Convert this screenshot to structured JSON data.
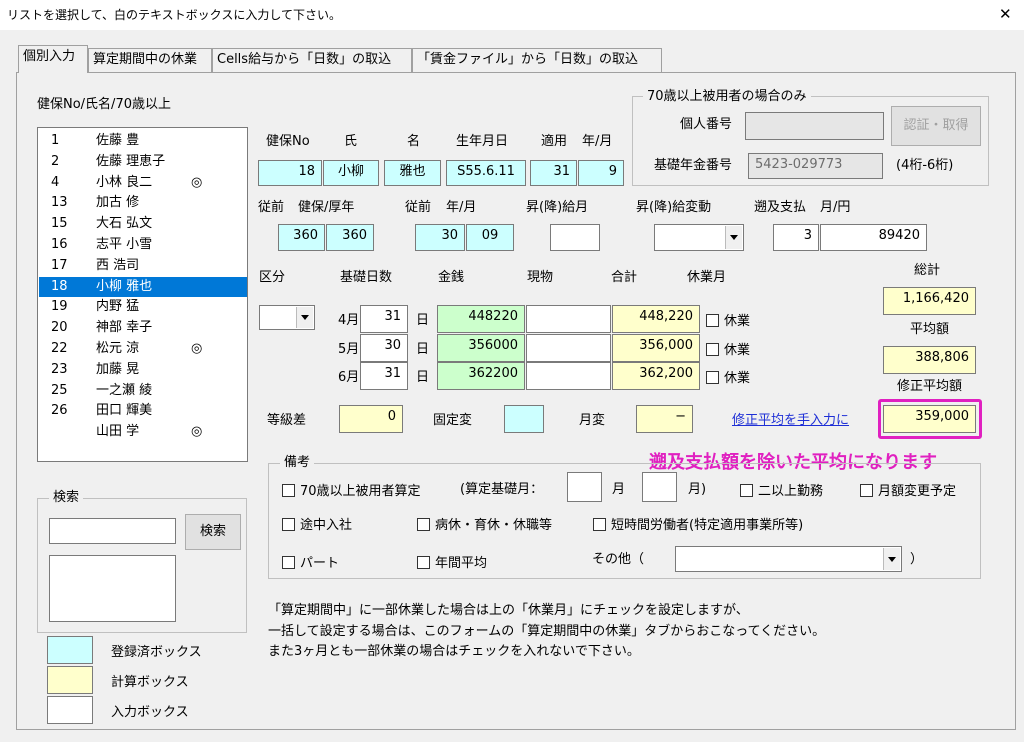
{
  "window": {
    "title": "リストを選択して、白のテキストボックスに入力して下さい。",
    "close_glyph": "✕"
  },
  "tabs": [
    "個別入力",
    "算定期間中の休業",
    "Cells給与から「日数」の取込",
    "「賃金ファイル」から「日数」の取込"
  ],
  "list_section": {
    "title": "健保No/氏名/70歳以上",
    "items": [
      {
        "no": "1",
        "name": "佐藤 豊",
        "mark": ""
      },
      {
        "no": "2",
        "name": "佐藤 理恵子",
        "mark": ""
      },
      {
        "no": "4",
        "name": "小林 良二",
        "mark": "◎"
      },
      {
        "no": "13",
        "name": "加古 修",
        "mark": ""
      },
      {
        "no": "15",
        "name": "大石 弘文",
        "mark": ""
      },
      {
        "no": "16",
        "name": "志平 小雪",
        "mark": ""
      },
      {
        "no": "17",
        "name": "西 浩司",
        "mark": ""
      },
      {
        "no": "18",
        "name": "小柳 雅也",
        "mark": ""
      },
      {
        "no": "19",
        "name": "内野 猛",
        "mark": ""
      },
      {
        "no": "20",
        "name": "神部 幸子",
        "mark": ""
      },
      {
        "no": "22",
        "name": "松元 涼",
        "mark": "◎"
      },
      {
        "no": "23",
        "name": "加藤 晃",
        "mark": ""
      },
      {
        "no": "25",
        "name": "一之瀬 綾",
        "mark": ""
      },
      {
        "no": "26",
        "name": "田口 輝美",
        "mark": ""
      },
      {
        "no": "",
        "name": "山田 学",
        "mark": "◎"
      }
    ],
    "selected_index": 7
  },
  "search": {
    "group_label": "検索",
    "input_value": "",
    "button_label": "検索",
    "result_value": ""
  },
  "legend": [
    {
      "label": "登録済ボックス",
      "color": "#ccffff"
    },
    {
      "label": "計算ボックス",
      "color": "#ffffcc"
    },
    {
      "label": "入力ボックス",
      "color": "#ffffff"
    }
  ],
  "employee": {
    "labels": {
      "kenpo": "健保No",
      "shi": "氏",
      "mei": "名",
      "birth": "生年月日",
      "tekiyo": "適用",
      "nengetsu": "年/月"
    },
    "kenpo_no": "18",
    "last_name": "小柳",
    "first_name": "雅也",
    "birthdate": "S55.6.11",
    "tekiyo_year": "31",
    "tekiyo_month": "9"
  },
  "over70": {
    "group_label": "70歳以上被用者の場合のみ",
    "kojin_label": "個人番号",
    "kojin_value": "",
    "auth_button": "認証・取得",
    "kiso_label": "基礎年金番号",
    "kiso_value": "5423-029773",
    "kiso_hint": "(4桁-6桁)"
  },
  "prev": {
    "labels": {
      "juzen1": "従前",
      "kenpo_kosei": "健保/厚年",
      "juzen2": "従前",
      "nengetsu": "年/月",
      "shokyu": "昇(降)給月",
      "shokyu_hendo": "昇(降)給変動",
      "sokyu": "遡及支払",
      "tsuki_en": "月/円"
    },
    "kenpo": "360",
    "kosei": "360",
    "year": "30",
    "month": "09",
    "shokyu_month": "",
    "shokyu_hendo": "",
    "sokyu_month": "3",
    "sokyu_amount": "89420"
  },
  "salary": {
    "headers": {
      "kubun": "区分",
      "kiso_nissu": "基礎日数",
      "kinsen": "金銭",
      "genbutsu": "現物",
      "gokei": "合計",
      "kyugyo_tsuki": "休業月",
      "sokei": "総計"
    },
    "kubun_value": "",
    "day_unit": "日",
    "kyugyo_label": "休業",
    "rows": [
      {
        "month": "4月",
        "days": "31",
        "kinsen": "448220",
        "genbutsu": "",
        "gokei": "448,220"
      },
      {
        "month": "5月",
        "days": "30",
        "kinsen": "356000",
        "genbutsu": "",
        "gokei": "356,000"
      },
      {
        "month": "6月",
        "days": "31",
        "kinsen": "362200",
        "genbutsu": "",
        "gokei": "362,200"
      }
    ],
    "sokei_value": "1,166,420",
    "heikin_label": "平均額",
    "heikin_value": "388,806",
    "shusei_label": "修正平均額",
    "shusei_value": "359,000",
    "tokyusa_label": "等級差",
    "tokyusa_value": "0",
    "koteihen_label": "固定変",
    "koteihen_value": "",
    "tsukihen_label": "月変",
    "tsukihen_value": "−",
    "manual_link": "修正平均を手入力に",
    "annotation": "遡及支払額を除いた平均になります",
    "highlight_color": "#e020c0"
  },
  "biko": {
    "group_label": "備考",
    "over70": "70歳以上被用者算定",
    "santei_kiso": "(算定基礎月：",
    "tsuki1": "月",
    "tsuki2": "月)",
    "nijo": "二以上勤務",
    "gakuhenko": "月額変更予定",
    "tochu": "途中入社",
    "byokyu": "病休・育休・休職等",
    "tanjikan": "短時間労働者(特定適用事業所等)",
    "part": "パート",
    "nenkan": "年間平均",
    "sonota": "その他（",
    "sonota_close": "）"
  },
  "notes": [
    "「算定期間中」に一部休業した場合は上の「休業月」にチェックを設定しますが、",
    "一括して設定する場合は、このフォームの「算定期間中の休業」タブからおこなってください。",
    "また3ヶ月とも一部休業の場合はチェックを入れないで下さい。"
  ]
}
